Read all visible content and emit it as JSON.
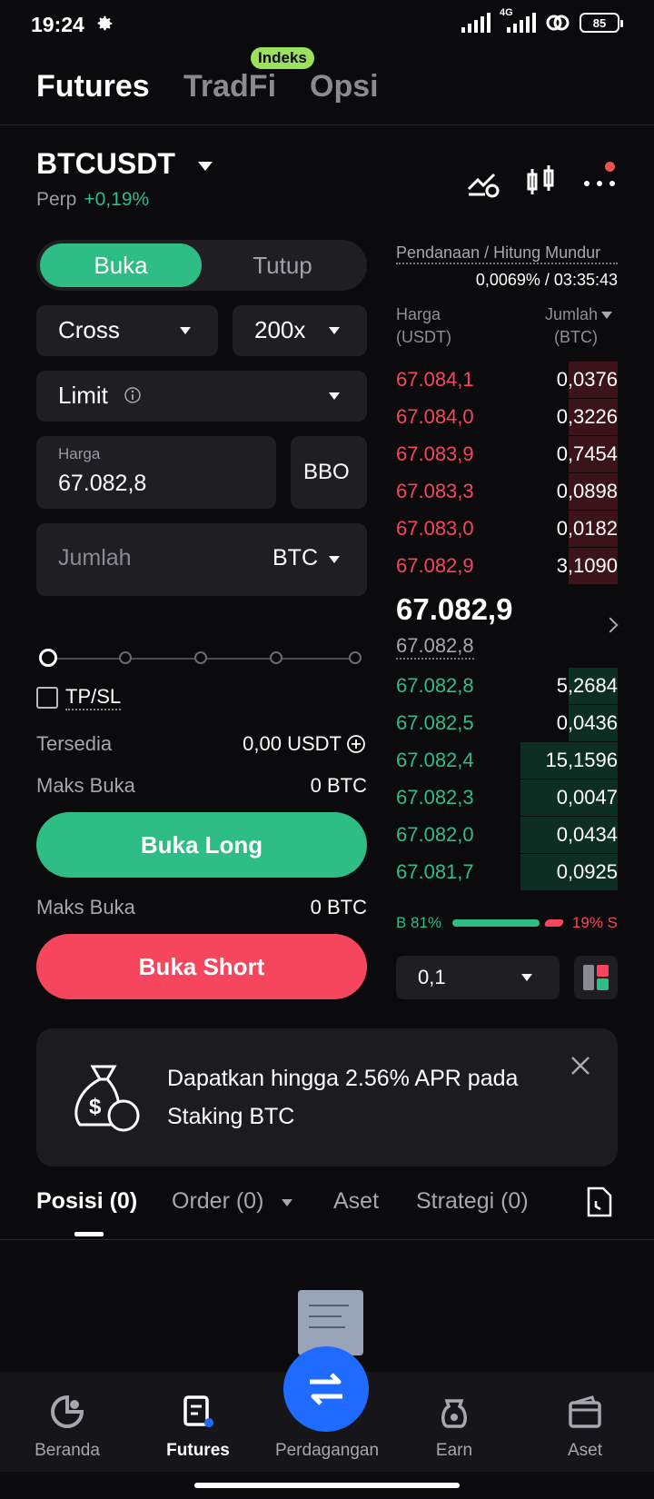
{
  "status": {
    "time": "19:24",
    "network": "4G",
    "battery": "85"
  },
  "topnav": {
    "tabs": [
      "Futures",
      "TradFi",
      "Opsi"
    ],
    "badge": "Indeks"
  },
  "symbol": {
    "name": "BTCUSDT",
    "type": "Perp",
    "change": "+0,19%"
  },
  "form": {
    "side_open": "Buka",
    "side_close": "Tutup",
    "margin_mode": "Cross",
    "leverage": "200x",
    "order_type": "Limit",
    "price_label": "Harga",
    "price_value": "67.082,8",
    "bbo": "BBO",
    "qty_placeholder": "Jumlah",
    "qty_unit": "BTC",
    "tpsl": "TP/SL",
    "available_label": "Tersedia",
    "available_value": "0,00 USDT",
    "max_open_label": "Maks Buka",
    "max_open_long": "0 BTC",
    "max_open_short": "0 BTC",
    "long_btn": "Buka Long",
    "short_btn": "Buka Short",
    "slider_position": 0
  },
  "orderbook": {
    "funding_label": "Pendanaan / Hitung Mundur",
    "funding_value": "0,0069% / 03:35:43",
    "col_price": "Harga\n(USDT)",
    "col_qty": "Jumlah\n(BTC)",
    "asks": [
      {
        "price": "67.084,1",
        "qty": "0,0376",
        "depth": 0.22
      },
      {
        "price": "67.084,0",
        "qty": "0,3226",
        "depth": 0.22
      },
      {
        "price": "67.083,9",
        "qty": "0,7454",
        "depth": 0.22
      },
      {
        "price": "67.083,3",
        "qty": "0,0898",
        "depth": 0.22
      },
      {
        "price": "67.083,0",
        "qty": "0,0182",
        "depth": 0.22
      },
      {
        "price": "67.082,9",
        "qty": "3,1090",
        "depth": 0.22
      }
    ],
    "last_price": "67.082,9",
    "mark_price": "67.082,8",
    "bids": [
      {
        "price": "67.082,8",
        "qty": "5,2684",
        "depth": 0.22
      },
      {
        "price": "67.082,5",
        "qty": "0,0436",
        "depth": 0.22
      },
      {
        "price": "67.082,4",
        "qty": "15,1596",
        "depth": 0.44
      },
      {
        "price": "67.082,3",
        "qty": "0,0047",
        "depth": 0.44
      },
      {
        "price": "67.082,0",
        "qty": "0,0434",
        "depth": 0.44
      },
      {
        "price": "67.081,7",
        "qty": "0,0925",
        "depth": 0.44
      }
    ],
    "buy_ratio": "B 81%",
    "sell_ratio": "19% S",
    "precision": "0,1"
  },
  "promo": {
    "text": "Dapatkan hingga 2.56% APR pada Staking BTC"
  },
  "position_tabs": [
    "Posisi (0)",
    "Order (0)",
    "Aset",
    "Strategi (0)"
  ],
  "bottomnav": [
    "Beranda",
    "Futures",
    "Perdagangan",
    "Earn",
    "Aset"
  ],
  "colors": {
    "green": "#2ebd85",
    "red": "#f6465d",
    "accent": "#1f6bff"
  }
}
